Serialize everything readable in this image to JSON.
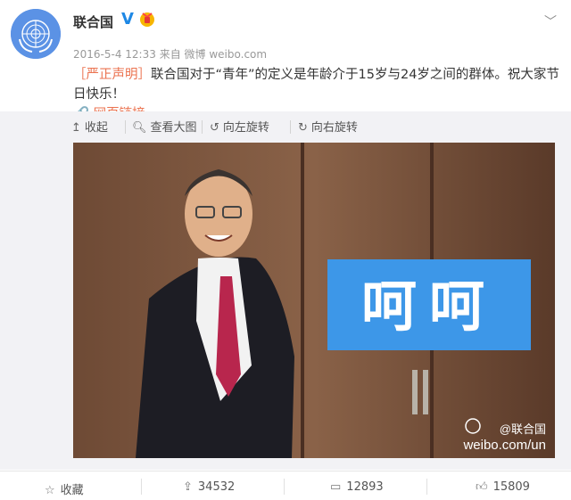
{
  "post": {
    "author": "联合国",
    "verified_badge": "V",
    "timestamp": "2016-5-4 12:33",
    "source_prefix": "来自",
    "source": "微博 weibo.com",
    "tag": "［严正声明］",
    "text_a": "联合国对于",
    "text_quoted": "“青年”",
    "text_b": "的定义是年龄介于15岁与24岁之间的群体。祝大家节日快乐！",
    "link_label": "网页链接"
  },
  "toolbar": {
    "collapse": "收起",
    "view_large": "查看大图",
    "rotate_left": "向左旋转",
    "rotate_right": "向右旋转"
  },
  "image": {
    "caption": "呵呵",
    "watermark_handle": "@联合国",
    "watermark_url": "weibo.com/un"
  },
  "actions": {
    "favorite": "收藏",
    "repost_count": "34532",
    "comment_count": "12893",
    "like_count": "15809"
  },
  "colors": {
    "accent": "#eb7350",
    "verified": "#1e88e5",
    "caption_bg": "#3d97e8"
  }
}
